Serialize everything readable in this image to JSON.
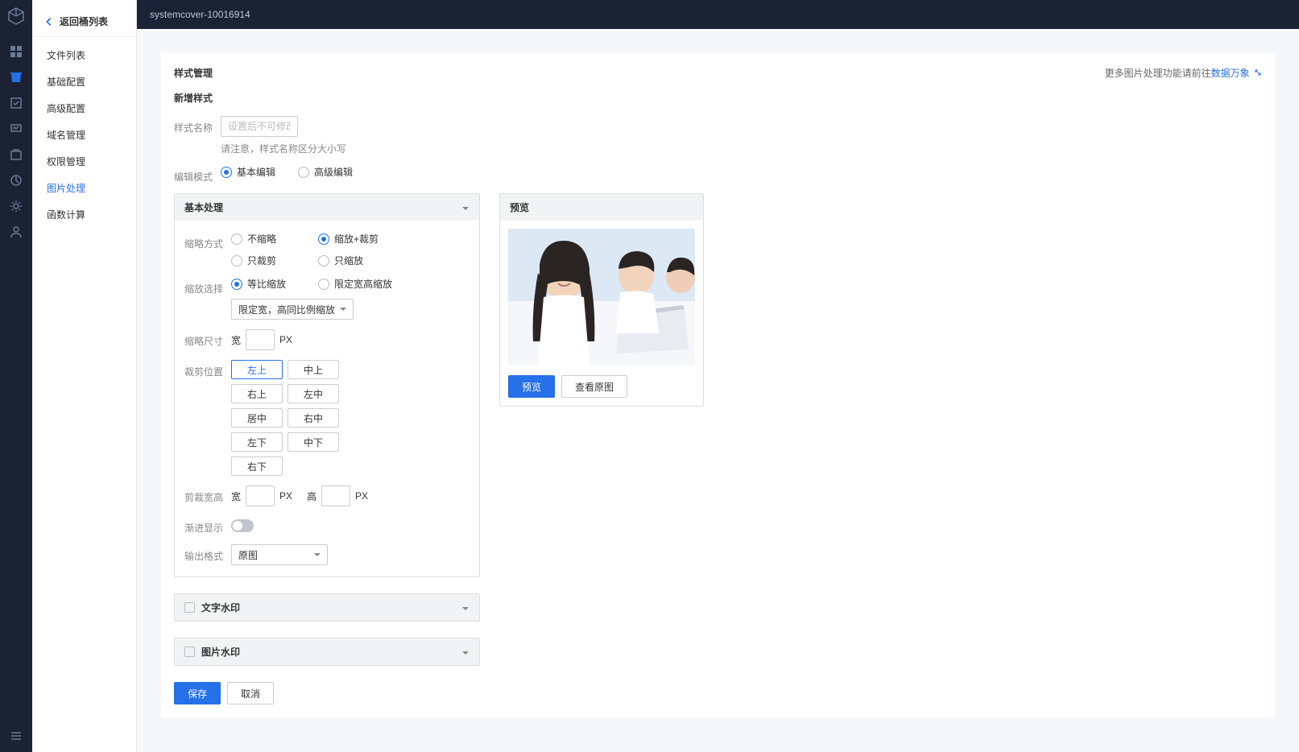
{
  "topbar": {
    "bucket_name": "systemcover-10016914"
  },
  "sidebar": {
    "back_label": "返回桶列表",
    "items": [
      {
        "label": "文件列表"
      },
      {
        "label": "基础配置"
      },
      {
        "label": "高级配置"
      },
      {
        "label": "域名管理"
      },
      {
        "label": "权限管理"
      },
      {
        "label": "图片处理"
      },
      {
        "label": "函数计算"
      }
    ],
    "active_index": 5
  },
  "page": {
    "section_title": "样式管理",
    "hint_prefix": "更多图片处理功能请前往",
    "hint_link_text": "数据万象",
    "subsection_title": "新增样式",
    "style_name_label": "样式名称",
    "style_name_placeholder": "设置后不可修改",
    "style_name_hint": "请注意，样式名称区分大小写",
    "edit_mode_label": "编辑模式",
    "edit_mode_options": {
      "basic": "基本编辑",
      "advanced": "高级编辑"
    },
    "edit_mode_selected": "basic"
  },
  "basic_panel": {
    "title": "基本处理",
    "thumb_mode_label": "缩略方式",
    "thumb_mode_options": {
      "none": "不缩略",
      "crop_only": "只裁剪",
      "scale_crop": "缩放+裁剪",
      "scale_only": "只缩放"
    },
    "thumb_mode_selected": "scale_crop",
    "scale_select_label": "缩放选择",
    "scale_select_options": {
      "eq_ratio": "等比缩放",
      "fixed_wh": "限定宽高缩放"
    },
    "scale_select_selected": "eq_ratio",
    "scale_dropdown_value": "限定宽，高同比例缩放",
    "thumb_size_label": "缩略尺寸",
    "width_label": "宽",
    "height_label": "高",
    "px_label": "PX",
    "crop_pos_label": "裁剪位置",
    "crop_positions": [
      "左上",
      "中上",
      "右上",
      "左中",
      "居中",
      "右中",
      "左下",
      "中下",
      "右下"
    ],
    "crop_pos_selected_index": 0,
    "crop_wh_label": "剪裁宽高",
    "progressive_label": "渐进显示",
    "output_format_label": "输出格式",
    "output_format_value": "原图"
  },
  "watermark_panels": {
    "text": "文字水印",
    "image": "图片水印"
  },
  "preview": {
    "title": "预览",
    "preview_btn": "预览",
    "view_original_btn": "查看原图"
  },
  "footer": {
    "save": "保存",
    "cancel": "取消"
  }
}
